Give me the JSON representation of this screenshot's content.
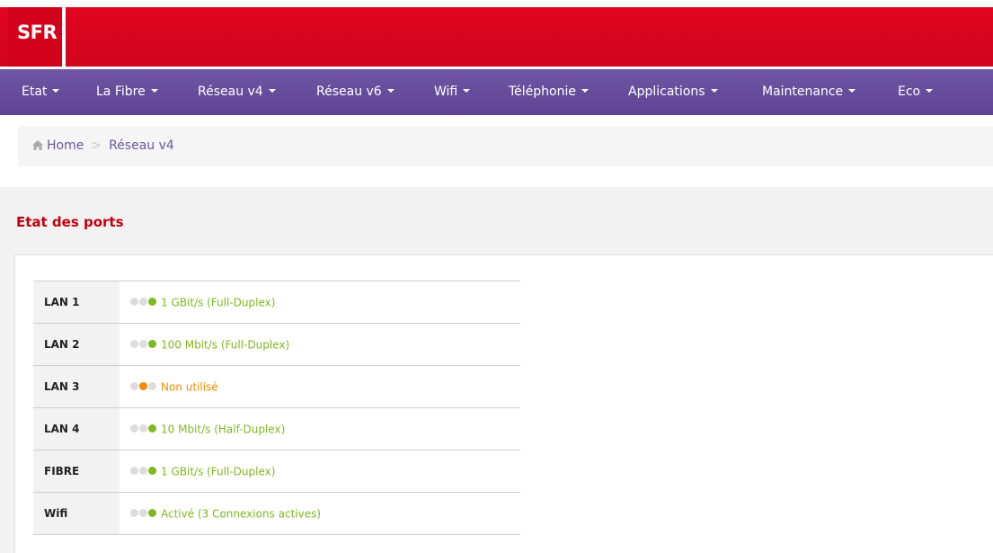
{
  "brand": {
    "logo_text": "SFR",
    "primary_color": "#d20019",
    "nav_color": "#644a9a"
  },
  "nav": {
    "items": [
      {
        "label": "Etat"
      },
      {
        "label": "La Fibre"
      },
      {
        "label": "Réseau v4"
      },
      {
        "label": "Réseau v6"
      },
      {
        "label": "Wifi"
      },
      {
        "label": "Téléphonie"
      },
      {
        "label": "Applications"
      },
      {
        "label": "Maintenance"
      },
      {
        "label": "Eco"
      }
    ]
  },
  "breadcrumb": {
    "home": "Home",
    "separator": ">",
    "current": "Réseau v4",
    "home_icon": "home-icon"
  },
  "section": {
    "title": "Etat des ports"
  },
  "ports": [
    {
      "label": "LAN 1",
      "status": "1 GBit/s (Full-Duplex)",
      "state": "green",
      "color": "#7fb81d"
    },
    {
      "label": "LAN 2",
      "status": "100 Mbit/s (Full-Duplex)",
      "state": "green",
      "color": "#7fb81d"
    },
    {
      "label": "LAN 3",
      "status": "Non utilisé",
      "state": "orange",
      "color": "#f08c00"
    },
    {
      "label": "LAN 4",
      "status": "10 Mbit/s (Half-Duplex)",
      "state": "green",
      "color": "#7fb81d"
    },
    {
      "label": "FIBRE",
      "status": "1 GBit/s (Full-Duplex)",
      "state": "green",
      "color": "#7fb81d"
    },
    {
      "label": "Wifi",
      "status": "Activé (3 Connexions actives)",
      "state": "green",
      "color": "#7fb81d"
    }
  ]
}
